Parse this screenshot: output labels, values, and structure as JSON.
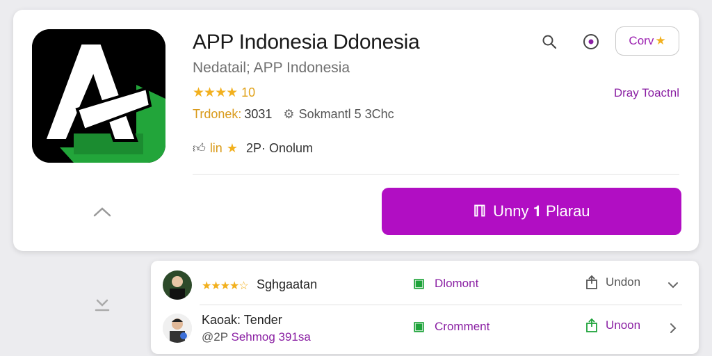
{
  "app": {
    "title": "APP Indonesia  Ddonesia",
    "subtitle": "Nedatail; APP Indonesia",
    "rating_stars": "★★★★",
    "rating_value": "10",
    "meta_a": "Trdonek:",
    "meta_b": "3031",
    "meta_c": "Sokmantl 5 3Chc",
    "stats_a": "lin",
    "stats_b": "2P· Onolum",
    "detail_link": "Dray Toactnl",
    "icon_colors": {
      "background": "#000000",
      "accent": "#22a53a",
      "letter": "#ffffff"
    }
  },
  "toolbar": {
    "follow_label": "Corv"
  },
  "primary_action": {
    "label": "Unny 𝟏 Plarau",
    "icon_glyph": "ℿ"
  },
  "reviews": [
    {
      "stars": "★★★★☆",
      "name": "Sghgaatan",
      "comment_label": "Dlomont",
      "share_label": "Undon"
    },
    {
      "name": "Kaoak: Tender",
      "handle": "@2P",
      "place": "Sehmog 391sa",
      "comment_label": "Cromment",
      "share_label": "Unoon"
    }
  ],
  "colors": {
    "primary": "#b10ec3",
    "accent_purple": "#8a1fa3",
    "star": "#f2b01e",
    "green": "#1ea33a"
  }
}
